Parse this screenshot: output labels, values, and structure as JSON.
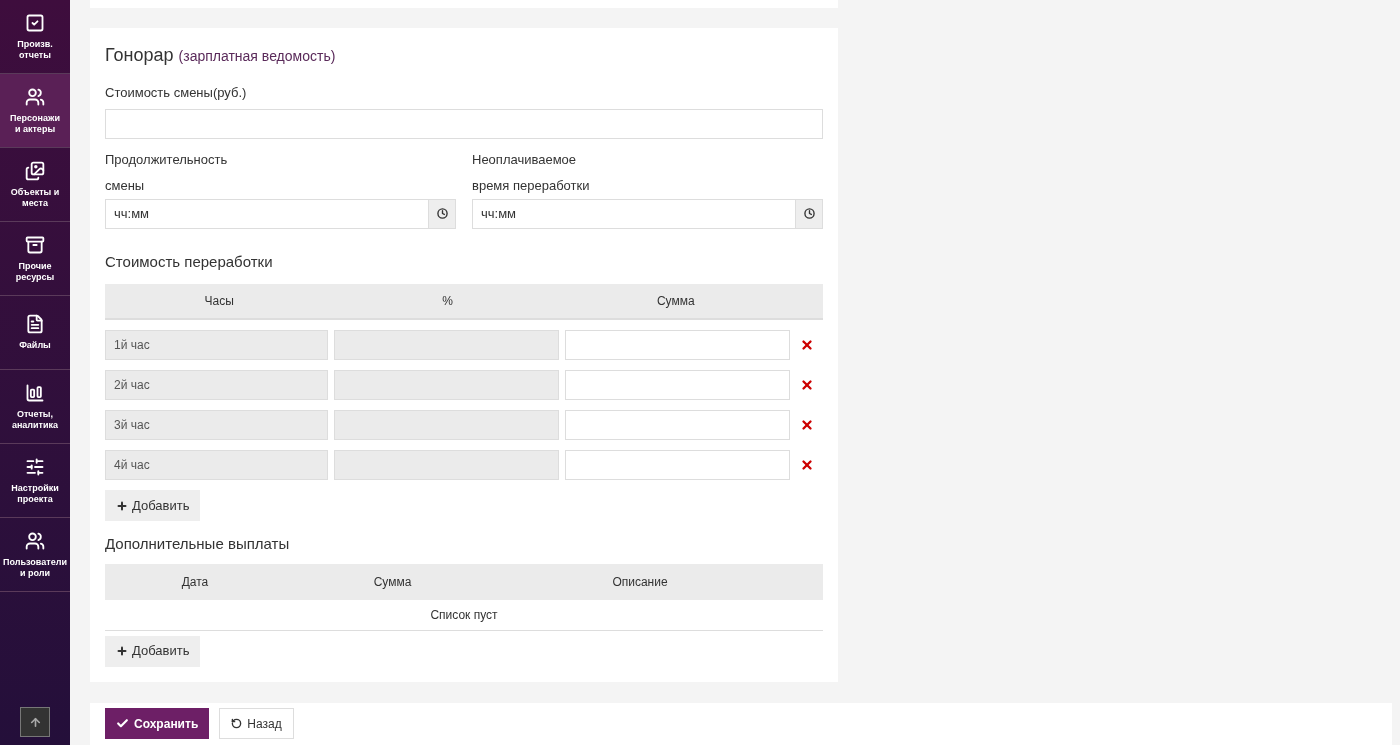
{
  "sidebar": {
    "items": [
      {
        "label": "Произв. отчеты",
        "selected": false
      },
      {
        "label": "Персонажи и актеры",
        "selected": true
      },
      {
        "label": "Объекты и места",
        "selected": false
      },
      {
        "label": "Прочие ресурсы",
        "selected": false
      },
      {
        "label": "Файлы",
        "selected": false
      },
      {
        "label": "Отчеты, аналитика",
        "selected": false
      },
      {
        "label": "Настройки проекта",
        "selected": false
      },
      {
        "label": "Пользователи и роли",
        "selected": false
      }
    ]
  },
  "fee": {
    "title": "Гонорар",
    "subtitle": "(зарплатная ведомость)",
    "shift_cost": {
      "label": "Стоимость смены(руб.)"
    },
    "shift_duration": {
      "label_lines": [
        "Продолжительность",
        "смены"
      ],
      "placeholder": "чч:мм"
    },
    "unpaid_overtime": {
      "label_lines": [
        "Неоплачиваемое",
        "время переработки"
      ],
      "placeholder": "чч:мм"
    },
    "overtime": {
      "title": "Стоимость переработки",
      "columns": [
        "Часы",
        "%",
        "Сумма"
      ],
      "rows": [
        {
          "hours": "1й час"
        },
        {
          "hours": "2й час"
        },
        {
          "hours": "3й час"
        },
        {
          "hours": "4й час"
        }
      ],
      "add_button": "Добавить"
    },
    "extra_payments": {
      "title": "Дополнительные выплаты",
      "columns": [
        "Дата",
        "Сумма",
        "Описание"
      ],
      "empty": "Список пуст",
      "add_button": "Добавить"
    }
  },
  "footer": {
    "save_button": "Сохранить",
    "back_button": "Назад"
  }
}
